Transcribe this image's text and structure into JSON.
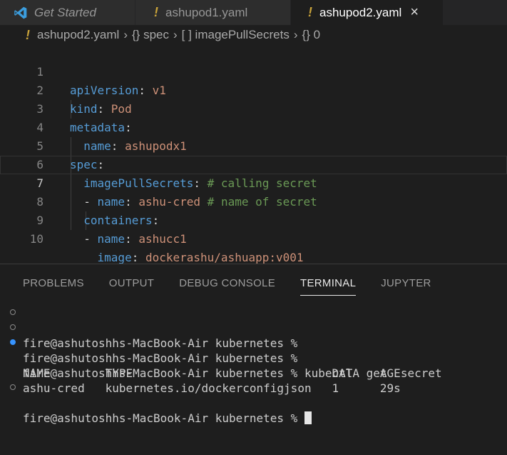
{
  "tabs": [
    {
      "label": "Get Started"
    },
    {
      "label": "ashupod1.yaml"
    },
    {
      "label": "ashupod2.yaml"
    }
  ],
  "breadcrumb": {
    "file": "ashupod2.yaml",
    "parts": [
      "{} spec",
      "[ ] imagePullSecrets",
      "{} 0"
    ]
  },
  "editor": {
    "lines": [
      {
        "n": "1",
        "key": "apiVersion",
        "val": "v1"
      },
      {
        "n": "2",
        "key": "kind",
        "val": "Pod"
      },
      {
        "n": "3",
        "key": "metadata"
      },
      {
        "n": "4",
        "key": "name",
        "val": "ashupodx1"
      },
      {
        "n": "5",
        "key": "spec"
      },
      {
        "n": "6",
        "key": "imagePullSecrets",
        "cmt": "# calling secret"
      },
      {
        "n": "7",
        "key": "name",
        "val": "ashu-cred",
        "cmt": "# name of secret"
      },
      {
        "n": "8",
        "key": "containers"
      },
      {
        "n": "9",
        "key": "name",
        "val": "ashucc1"
      },
      {
        "n": "10",
        "key": "image",
        "val": "dockerashu/ashuapp:v001"
      }
    ]
  },
  "panel": {
    "tabs": [
      "PROBLEMS",
      "OUTPUT",
      "DEBUG CONSOLE",
      "TERMINAL",
      "JUPYTER"
    ],
    "active_tab": "TERMINAL"
  },
  "terminal": {
    "prompt": "fire@ashutoshhs-MacBook-Air kubernetes %",
    "command": "kubectl  get  secret",
    "header": "NAME        TYPE                             DATA   AGE",
    "row": "ashu-cred   kubernetes.io/dockerconfigjson   1      29s"
  }
}
